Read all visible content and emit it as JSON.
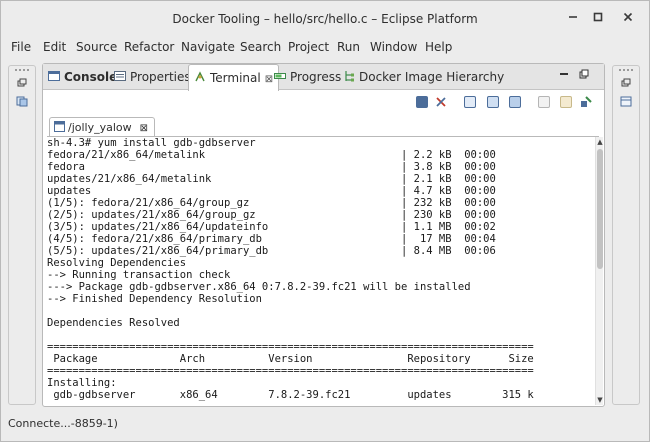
{
  "window": {
    "title": "Docker Tooling – hello/src/hello.c – Eclipse Platform",
    "controls": {
      "minimize": "✕",
      "maximize": "□",
      "close": "×"
    }
  },
  "menu": [
    "File",
    "Edit",
    "Source",
    "Refactor",
    "Navigate",
    "Search",
    "Project",
    "Run",
    "Window",
    "Help"
  ],
  "tabs": [
    {
      "label": "Console",
      "icon": "console-icon",
      "active": false
    },
    {
      "label": "Properties",
      "icon": "properties-icon",
      "active": false
    },
    {
      "label": "Terminal",
      "icon": "terminal-icon",
      "active": true
    },
    {
      "label": "Progress",
      "icon": "progress-icon",
      "active": false
    },
    {
      "label": "Docker Image Hierarchy",
      "icon": "docker-hierarchy-icon",
      "active": false
    }
  ],
  "view_controls": {
    "minimize": "▬",
    "maximize": "▣"
  },
  "session": {
    "label": "/jolly_yalow"
  },
  "colors": {
    "accent": "#4c6d9a",
    "terminal_bg": "#ffffff",
    "chrome_bg": "#ececec"
  },
  "terminal_lines": [
    "sh-4.3# yum install gdb-gdbserver",
    "fedora/21/x86_64/metalink                               | 2.2 kB  00:00",
    "fedora                                                  | 3.8 kB  00:00",
    "updates/21/x86_64/metalink                              | 2.1 kB  00:00",
    "updates                                                 | 4.7 kB  00:00",
    "(1/5): fedora/21/x86_64/group_gz                        | 232 kB  00:00",
    "(2/5): updates/21/x86_64/group_gz                       | 230 kB  00:00",
    "(3/5): updates/21/x86_64/updateinfo                     | 1.1 MB  00:02",
    "(4/5): fedora/21/x86_64/primary_db                      |  17 MB  00:04",
    "(5/5): updates/21/x86_64/primary_db                     | 8.4 MB  00:06",
    "Resolving Dependencies",
    "--> Running transaction check",
    "---> Package gdb-gdbserver.x86_64 0:7.8.2-39.fc21 will be installed",
    "--> Finished Dependency Resolution",
    "",
    "Dependencies Resolved",
    "",
    "=============================================================================",
    " Package             Arch          Version               Repository      Size",
    "=============================================================================",
    "Installing:",
    " gdb-gdbserver       x86_64        7.8.2-39.fc21         updates        315 k"
  ],
  "status": {
    "text": "Connecte...-8859-1)"
  }
}
